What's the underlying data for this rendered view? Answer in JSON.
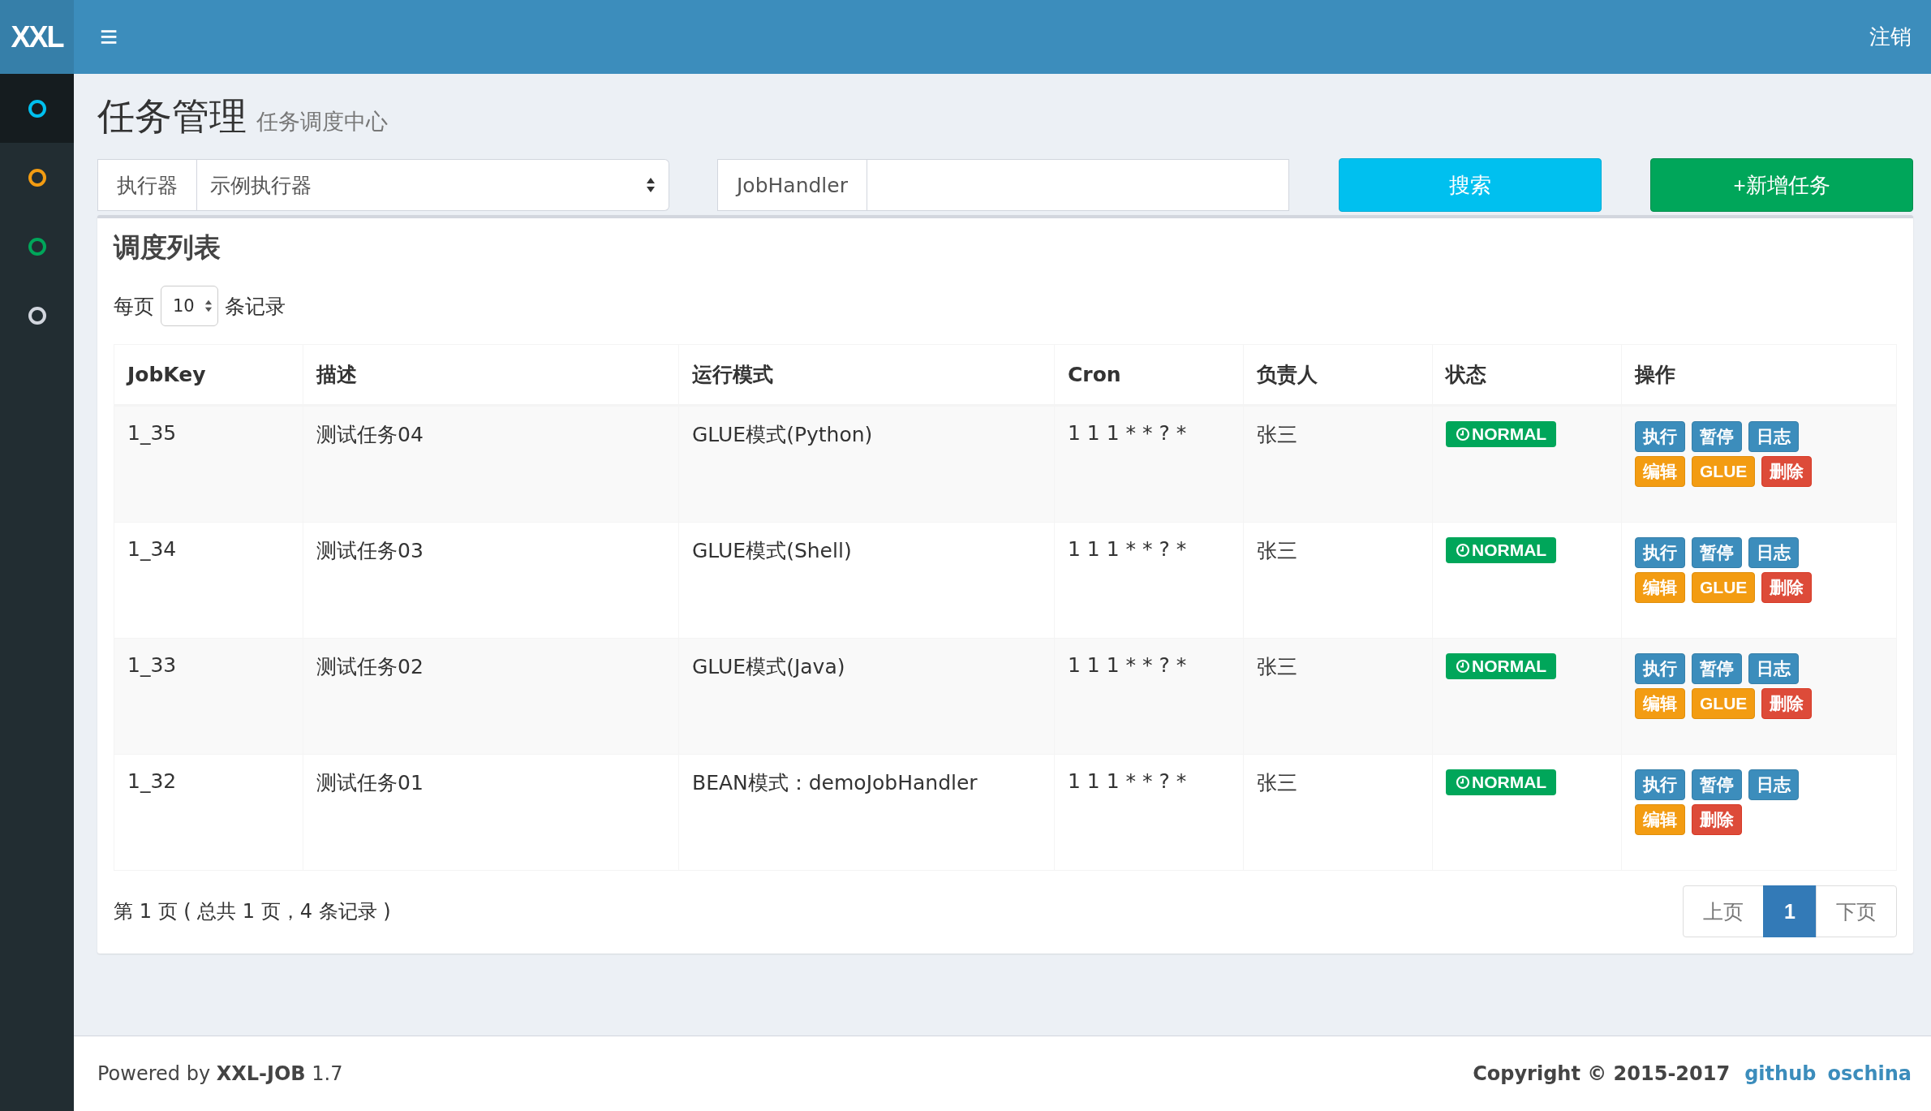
{
  "header": {
    "logo": "XXL",
    "menu_icon": "≡",
    "logout": "注销"
  },
  "sidebar": {
    "items": [
      {
        "color": "#00c0ef",
        "selected": true
      },
      {
        "color": "#f39c12",
        "selected": false
      },
      {
        "color": "#00a65a",
        "selected": false
      },
      {
        "color": "#d2d6de",
        "selected": false
      }
    ]
  },
  "page": {
    "title": "任务管理",
    "subtitle": "任务调度中心"
  },
  "filters": {
    "executor_label": "执行器",
    "executor_value": "示例执行器",
    "jobhandler_label": "JobHandler",
    "search_button": "搜索",
    "add_button": "+新增任务"
  },
  "box": {
    "title": "调度列表",
    "page_size_label": "每页",
    "page_size": "10",
    "page_size_suffix": "条记录"
  },
  "table": {
    "columns": [
      "JobKey",
      "描述",
      "运行模式",
      "Cron",
      "负责人",
      "状态",
      "操作"
    ],
    "rows": [
      {
        "jobkey": "1_35",
        "desc": "测试任务04",
        "mode": "GLUE模式(Python)",
        "cron": "1 1 1 * * ? *",
        "owner": "张三",
        "status": "NORMAL",
        "actions": [
          {
            "label": "执行",
            "kind": "primary"
          },
          {
            "label": "暂停",
            "kind": "primary"
          },
          {
            "label": "日志",
            "kind": "primary"
          },
          {
            "label": "编辑",
            "kind": "warning"
          },
          {
            "label": "GLUE",
            "kind": "warning"
          },
          {
            "label": "删除",
            "kind": "danger"
          }
        ]
      },
      {
        "jobkey": "1_34",
        "desc": "测试任务03",
        "mode": "GLUE模式(Shell)",
        "cron": "1 1 1 * * ? *",
        "owner": "张三",
        "status": "NORMAL",
        "actions": [
          {
            "label": "执行",
            "kind": "primary"
          },
          {
            "label": "暂停",
            "kind": "primary"
          },
          {
            "label": "日志",
            "kind": "primary"
          },
          {
            "label": "编辑",
            "kind": "warning"
          },
          {
            "label": "GLUE",
            "kind": "warning"
          },
          {
            "label": "删除",
            "kind": "danger"
          }
        ]
      },
      {
        "jobkey": "1_33",
        "desc": "测试任务02",
        "mode": "GLUE模式(Java)",
        "cron": "1 1 1 * * ? *",
        "owner": "张三",
        "status": "NORMAL",
        "actions": [
          {
            "label": "执行",
            "kind": "primary"
          },
          {
            "label": "暂停",
            "kind": "primary"
          },
          {
            "label": "日志",
            "kind": "primary"
          },
          {
            "label": "编辑",
            "kind": "warning"
          },
          {
            "label": "GLUE",
            "kind": "warning"
          },
          {
            "label": "删除",
            "kind": "danger"
          }
        ]
      },
      {
        "jobkey": "1_32",
        "desc": "测试任务01",
        "mode": "BEAN模式：demoJobHandler",
        "cron": "1 1 1 * * ? *",
        "owner": "张三",
        "status": "NORMAL",
        "actions": [
          {
            "label": "执行",
            "kind": "primary"
          },
          {
            "label": "暂停",
            "kind": "primary"
          },
          {
            "label": "日志",
            "kind": "primary"
          },
          {
            "label": "编辑",
            "kind": "warning"
          },
          {
            "label": "删除",
            "kind": "danger"
          }
        ]
      }
    ]
  },
  "pagination": {
    "info": "第 1 页 ( 总共 1 页，4 条记录 )",
    "prev": "上页",
    "pages": [
      {
        "label": "1",
        "selected": true
      }
    ],
    "next": "下页"
  },
  "footer": {
    "powered": "Powered by **XXL-JOB** 1.7",
    "copyright": "Copyright © 2015-2017",
    "links": [
      "github",
      "oschina"
    ]
  }
}
